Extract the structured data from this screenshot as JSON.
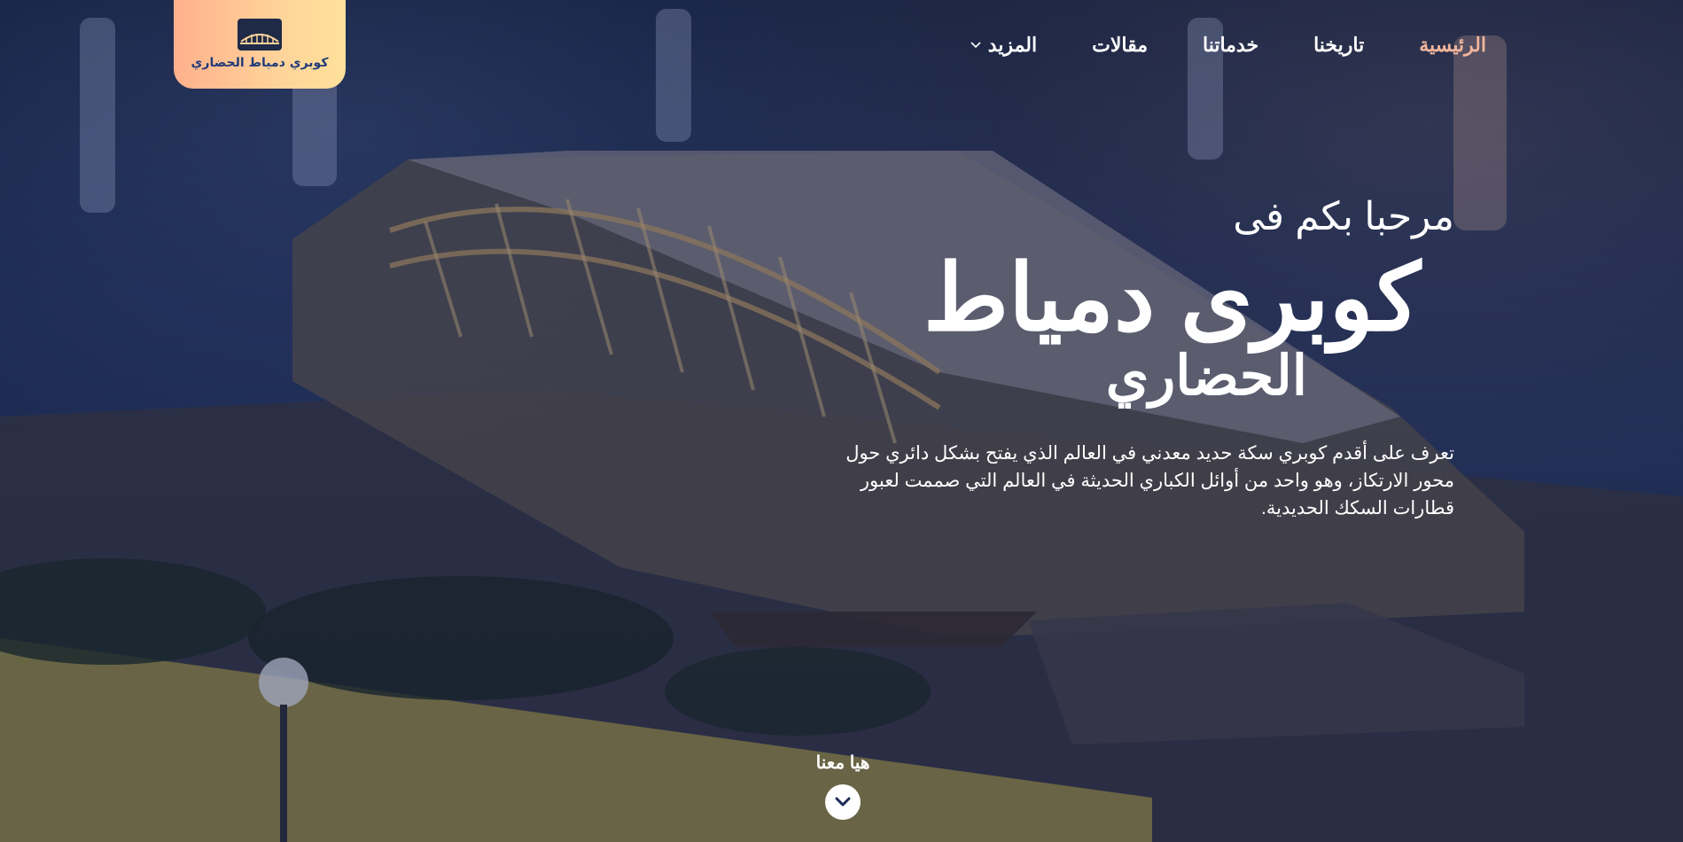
{
  "logo": {
    "text": "كوبري دمياط الحضاري",
    "icon": "bridge-logo-icon"
  },
  "nav": {
    "items": [
      {
        "label": "الرئيسية",
        "active": true
      },
      {
        "label": "تاريخنا",
        "active": false
      },
      {
        "label": "خدماتنا",
        "active": false
      },
      {
        "label": "مقالات",
        "active": false
      },
      {
        "label": "المزيد",
        "active": false,
        "has_dropdown": true
      }
    ]
  },
  "hero": {
    "welcome": "مرحبا بكم فى",
    "title": "كوبرى دمياط",
    "subtitle": "الحضاري",
    "description": "تعرف على أقدم كوبري سكة حديد معدني في العالم الذي يفتح بشكل دائري حول محور الارتكاز، وهو واحد من أوائل الكباري الحديثة في العالم التي صممت لعبور قطارات السكك الحديدية."
  },
  "scroll_cue": {
    "label": "هيا معنا",
    "icon": "chevron-down-icon"
  },
  "colors": {
    "accent": "#f0b59b",
    "logo_gradient_start": "#ffb08c",
    "logo_gradient_end": "#ffe19b",
    "logo_text": "#203a7a",
    "overlay": "#1e2c55"
  }
}
